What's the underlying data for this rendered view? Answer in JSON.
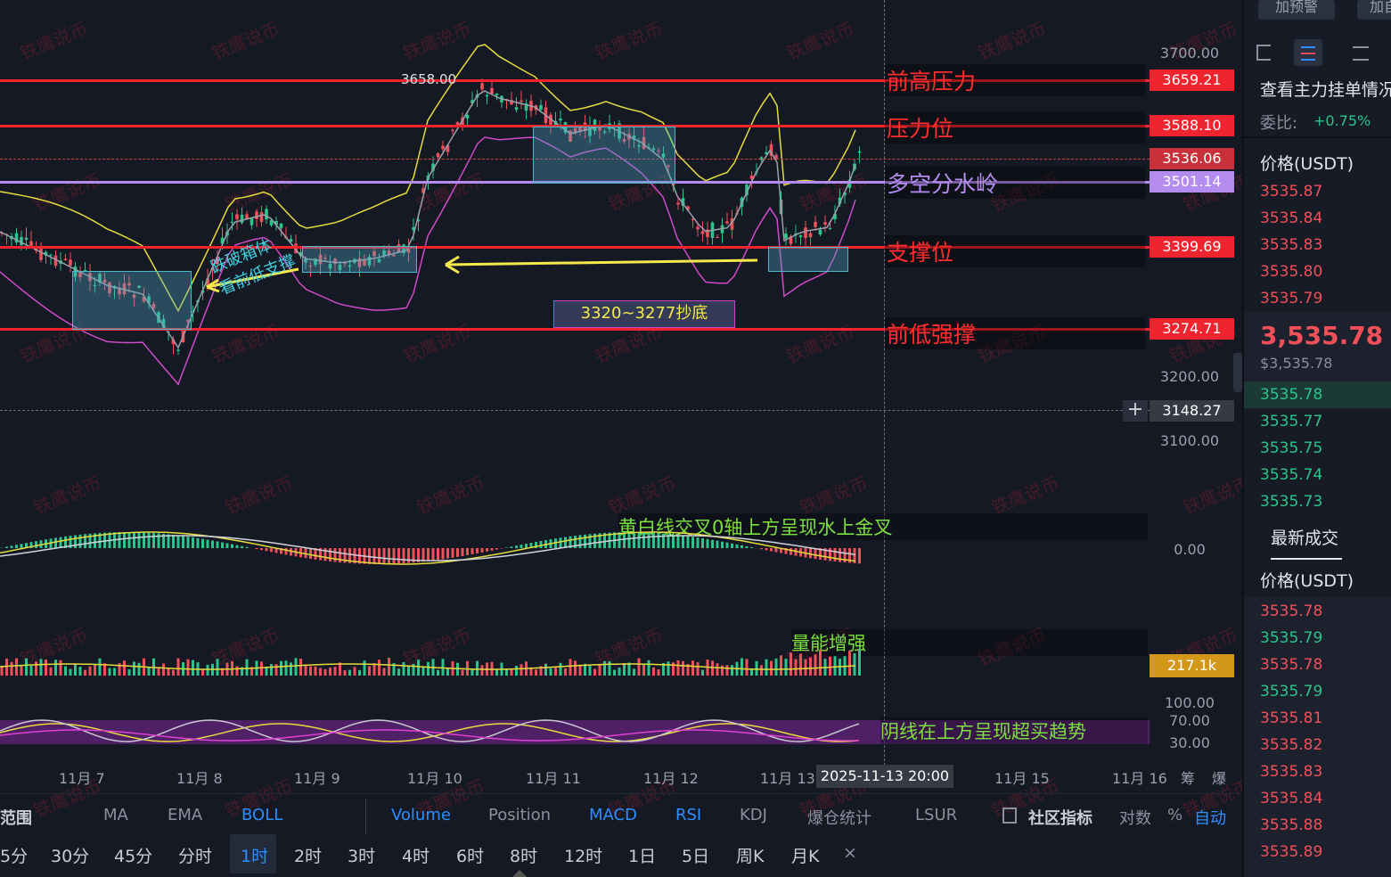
{
  "watermark": "铁鹰说币",
  "price_levels": [
    {
      "price": "3659.21",
      "label": "前高压力",
      "color": "#f0242e"
    },
    {
      "price": "3588.10",
      "label": "压力位",
      "color": "#f0242e"
    },
    {
      "price": "3501.14",
      "label": "多空分水岭",
      "color": "#b48cf0"
    },
    {
      "price": "3399.69",
      "label": "支撑位",
      "color": "#f0242e"
    },
    {
      "price": "3274.71",
      "label": "前低强撑",
      "color": "#f0242e"
    }
  ],
  "current_price_tag": "3536.06",
  "crosshair_price": "3148.27",
  "high_marker": "3658.00",
  "y_axis": [
    "3700.00",
    "3200.00",
    "3100.00"
  ],
  "x_axis": [
    "11月 7",
    "11月 8",
    "11月 9",
    "11月 10",
    "11月 11",
    "11月 12",
    "11月 13",
    "11月 15",
    "11月 16"
  ],
  "crosshair_time": "2025-11-13 20:00",
  "x_axis_right": [
    "筹",
    "爆"
  ],
  "annotations": {
    "break_box_1": "跌破箱体",
    "break_box_2": "看前低支撑",
    "bottom_range": "3320~3277抄底",
    "macd_note": "黄白线交叉0轴上方呈现水上金叉",
    "volume_note": "量能增强",
    "rsi_note": "阴线在上方呈现超买趋势"
  },
  "macd": {
    "zero_label": "0.00"
  },
  "volume": {
    "tag": "217.1k"
  },
  "rsi": {
    "levels": [
      "100.00",
      "70.00",
      "30.00"
    ]
  },
  "indicator_bar": {
    "items": [
      {
        "label": "范围",
        "color": "#c9ccd6"
      },
      {
        "label": "MA",
        "color": "#8a909d"
      },
      {
        "label": "EMA",
        "color": "#8a909d"
      },
      {
        "label": "BOLL",
        "color": "#2e8dff"
      },
      {
        "label": "Volume",
        "color": "#2e8dff"
      },
      {
        "label": "Position",
        "color": "#8a909d"
      },
      {
        "label": "MACD",
        "color": "#2e8dff"
      },
      {
        "label": "RSI",
        "color": "#2e8dff"
      },
      {
        "label": "KDJ",
        "color": "#8a909d"
      },
      {
        "label": "爆仓统计",
        "color": "#8a909d"
      },
      {
        "label": "LSUR",
        "color": "#8a909d"
      },
      {
        "label": "社区指标",
        "color": "#c9ccd6"
      },
      {
        "label": "对数",
        "color": "#8a909d"
      },
      {
        "label": "%",
        "color": "#8a909d"
      },
      {
        "label": "自动",
        "color": "#2e8dff"
      }
    ]
  },
  "timeframes": {
    "items": [
      "5分",
      "30分",
      "45分",
      "分时",
      "1时",
      "2时",
      "3时",
      "4时",
      "6时",
      "8时",
      "12时",
      "1日",
      "5日",
      "周K",
      "月K"
    ],
    "active": "1时",
    "close": "×"
  },
  "sidebar": {
    "alert_buttons": [
      "加预警",
      "加自"
    ],
    "orderbook_title": "查看主力挂单情况",
    "ratio_label": "委比:",
    "ratio_value": "+0.75%",
    "price_header": "价格(USDT)",
    "asks": [
      "3535.87",
      "3535.84",
      "3535.83",
      "3535.80",
      "3535.79"
    ],
    "last_price": "3,535.78",
    "last_price_usd": "$3,535.78",
    "bids": [
      "3535.78",
      "3535.77",
      "3535.75",
      "3535.74",
      "3535.73"
    ],
    "trades_title": "最新成交",
    "trades_header": "价格(USDT)",
    "trades": [
      {
        "price": "3535.78",
        "side": "sell"
      },
      {
        "price": "3535.79",
        "side": "buy"
      },
      {
        "price": "3535.78",
        "side": "sell"
      },
      {
        "price": "3535.79",
        "side": "buy"
      },
      {
        "price": "3535.81",
        "side": "sell"
      },
      {
        "price": "3535.82",
        "side": "sell"
      },
      {
        "price": "3535.83",
        "side": "sell"
      },
      {
        "price": "3535.84",
        "side": "sell"
      },
      {
        "price": "3535.88",
        "side": "sell"
      },
      {
        "price": "3535.89",
        "side": "sell"
      }
    ]
  }
}
